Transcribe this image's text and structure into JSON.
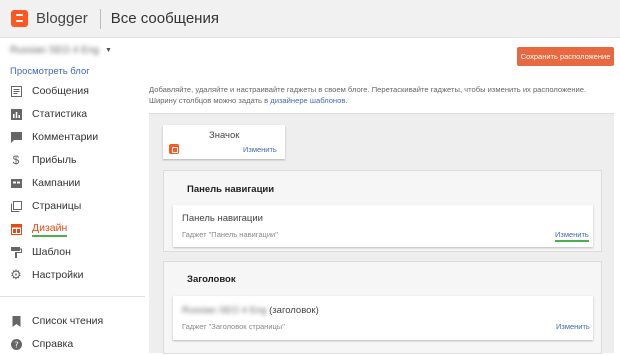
{
  "app": {
    "brand": "Blogger",
    "section_title": "Все сообщения"
  },
  "blog_selector": {
    "name": "Russian SEO 4 Eng"
  },
  "view_blog": "Просмотреть блог",
  "sidebar": {
    "items": [
      {
        "label": "Сообщения",
        "icon": "posts-icon"
      },
      {
        "label": "Статистика",
        "icon": "stats-icon"
      },
      {
        "label": "Комментарии",
        "icon": "comments-icon"
      },
      {
        "label": "Прибыль",
        "icon": "dollar-icon"
      },
      {
        "label": "Кампании",
        "icon": "campaigns-icon"
      },
      {
        "label": "Страницы",
        "icon": "pages-icon"
      },
      {
        "label": "Дизайн",
        "icon": "layout-icon",
        "active": true
      },
      {
        "label": "Шаблон",
        "icon": "theme-icon"
      },
      {
        "label": "Настройки",
        "icon": "gear-icon"
      },
      {
        "label": "Список чтения",
        "icon": "bookmark-icon"
      },
      {
        "label": "Справка",
        "icon": "help-icon"
      }
    ]
  },
  "toolbar": {
    "save_label": "Сохранить расположение"
  },
  "description": {
    "text": "Добавляйте, удаляйте и настраивайте гаджеты в своем блоге. Перетаскивайте гаджеты, чтобы изменить их расположение. Ширину столбцов можно задать в ",
    "link": "дизайнере шаблонов",
    "end": "."
  },
  "layout": {
    "favicon_gadget": {
      "title": "Значок",
      "edit": "Изменить"
    },
    "navbar_section": {
      "header": "Панель навигации",
      "gadget_title": "Панель навигации",
      "gadget_sub": "Гаджет \"Панель навигации\"",
      "edit": "Изменить"
    },
    "header_section": {
      "header": "Заголовок",
      "gadget_blog_name": "Russian SEO 4 Eng",
      "gadget_title_suffix": "(заголовок)",
      "gadget_sub": "Гаджет \"Заголовок страницы\"",
      "edit": "Изменить"
    }
  },
  "colors": {
    "accent": "#ff5722",
    "save_button": "#e8693f",
    "link": "#3f6ab3",
    "active_underline": "#4caf50"
  }
}
